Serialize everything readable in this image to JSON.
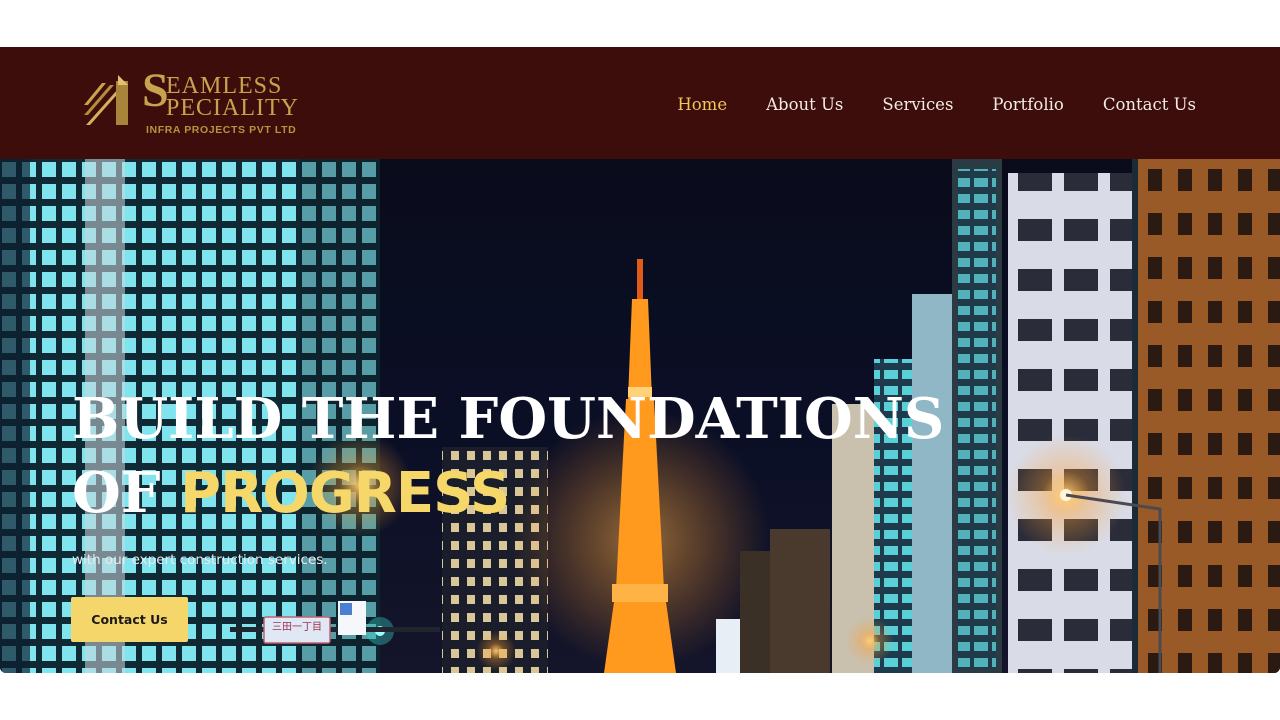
{
  "brand": {
    "logo_initial": "S",
    "logo_line1": "EAMLESS",
    "logo_line2": "PECIALITY",
    "logo_subline": "INFRA PROJECTS PVT LTD",
    "gold": "#c9a24e"
  },
  "nav": {
    "items": [
      {
        "label": "Home",
        "active": true
      },
      {
        "label": "About Us",
        "active": false
      },
      {
        "label": "Services",
        "active": false
      },
      {
        "label": "Portfolio",
        "active": false
      },
      {
        "label": "Contact Us",
        "active": false
      }
    ]
  },
  "hero": {
    "headline_line1": "BUILD THE FOUNDATIONS",
    "headline_line2_prefix": "OF ",
    "headline_line2_accent": "PROGRESS",
    "tagline": "with our expert construction services.",
    "cta_label": "Contact Us",
    "background_image": "night-city-skyline-with-tokyo-tower",
    "street_sign_text": "三田一丁目"
  },
  "colors": {
    "header_bg": "#3d0d0b",
    "accent": "#f5d76a",
    "nav_active": "#f0c55a",
    "button_bg": "#f4d66a"
  }
}
